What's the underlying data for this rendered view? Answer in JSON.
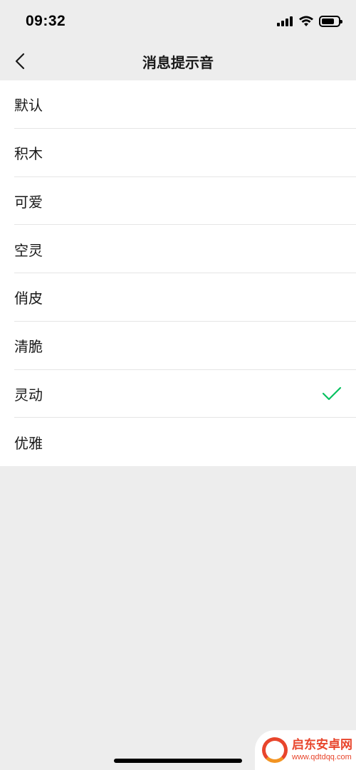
{
  "status_bar": {
    "time": "09:32"
  },
  "nav": {
    "title": "消息提示音"
  },
  "sounds": [
    {
      "label": "默认",
      "selected": false
    },
    {
      "label": "积木",
      "selected": false
    },
    {
      "label": "可爱",
      "selected": false
    },
    {
      "label": "空灵",
      "selected": false
    },
    {
      "label": "俏皮",
      "selected": false
    },
    {
      "label": "清脆",
      "selected": false
    },
    {
      "label": "灵动",
      "selected": true
    },
    {
      "label": "优雅",
      "selected": false
    }
  ],
  "colors": {
    "check": "#07c160",
    "background": "#ededed"
  },
  "watermark": {
    "title": "启东安卓网",
    "url": "www.qdtdqq.com"
  }
}
